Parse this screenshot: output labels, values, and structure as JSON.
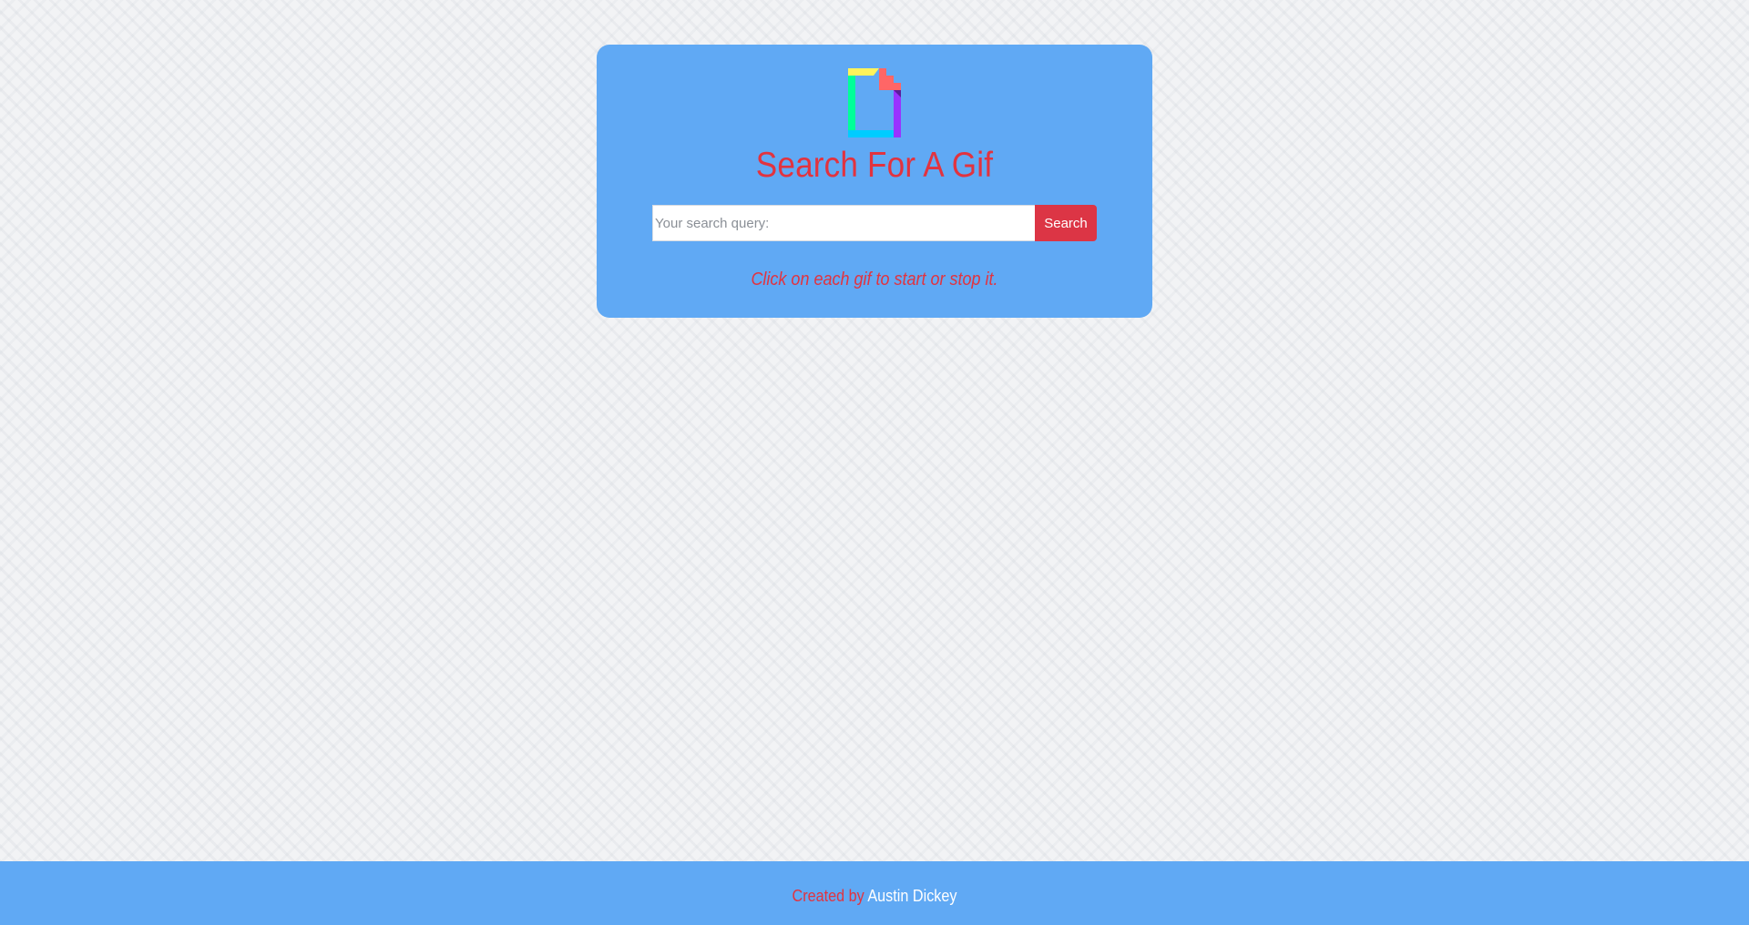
{
  "header": {
    "logo_icon": "giphy-logo-icon",
    "title": "Search For A Gif"
  },
  "search": {
    "placeholder": "Your search query:",
    "value": "",
    "button_label": "Search"
  },
  "hint": {
    "text": "Click on each gif to start or stop it."
  },
  "footer": {
    "prefix": "Created by",
    "author": "Austin Dickey"
  },
  "colors": {
    "panel": "#60a9f4",
    "accent": "#e2333f",
    "button": "#dc3545",
    "page_background": "#f2f3f5"
  }
}
